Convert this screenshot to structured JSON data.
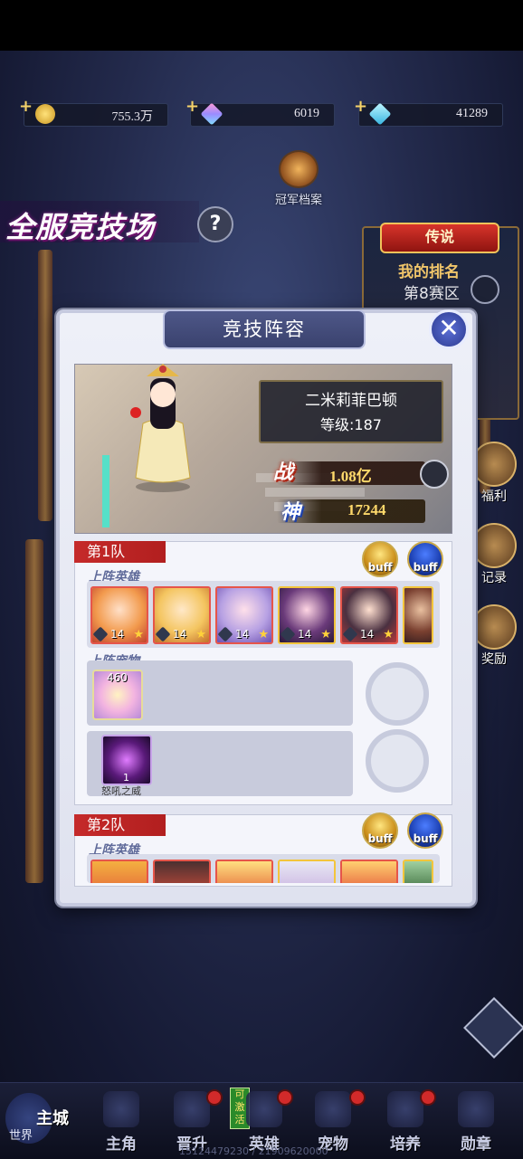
{
  "resources": [
    {
      "name": "gold",
      "value": "755.3万",
      "color": "#f3c533"
    },
    {
      "name": "rainbow-gem",
      "value": "6019",
      "color": "#b98cff"
    },
    {
      "name": "diamond",
      "value": "41289",
      "color": "#5fd1f1"
    }
  ],
  "arena": {
    "title": "全服竞技场",
    "champion_record": "冠军档案",
    "help": "?"
  },
  "legend_panel": {
    "banner": "传说",
    "my_rank": "我的排名",
    "zone": "第8赛区",
    "side_buttons": [
      "福利",
      "记录",
      "奖励"
    ]
  },
  "modal": {
    "title": "竞技阵容",
    "close": "✕",
    "player": {
      "name": "二米莉菲巴顿",
      "level": "等级:187",
      "power_label": "战",
      "power": "1.08亿",
      "god_label": "神",
      "god_power": "17244"
    },
    "teams": [
      {
        "label": "第1队",
        "heroes_label": "上阵英雄",
        "pets_label": "上阵宠物",
        "buffs": [
          "buff",
          "buff"
        ],
        "heroes": [
          {
            "level": "14",
            "border": "red"
          },
          {
            "level": "14",
            "border": "red"
          },
          {
            "level": "14",
            "border": "red"
          },
          {
            "level": "14",
            "border": "gold"
          },
          {
            "level": "14",
            "border": "red"
          }
        ],
        "pet_power": "460",
        "treasure_level": "1",
        "treasure_name": "怒吼之威"
      },
      {
        "label": "第2队",
        "heroes_label": "上阵英雄",
        "buffs": [
          "buff",
          "buff"
        ]
      }
    ]
  },
  "bottom_nav": {
    "world": "世界",
    "main_city": "主城",
    "activate": "可激活",
    "items": [
      "主角",
      "晋升",
      "英雄",
      "宠物",
      "培养",
      "勋章"
    ],
    "uid": "15124479230 / 21909620000"
  }
}
